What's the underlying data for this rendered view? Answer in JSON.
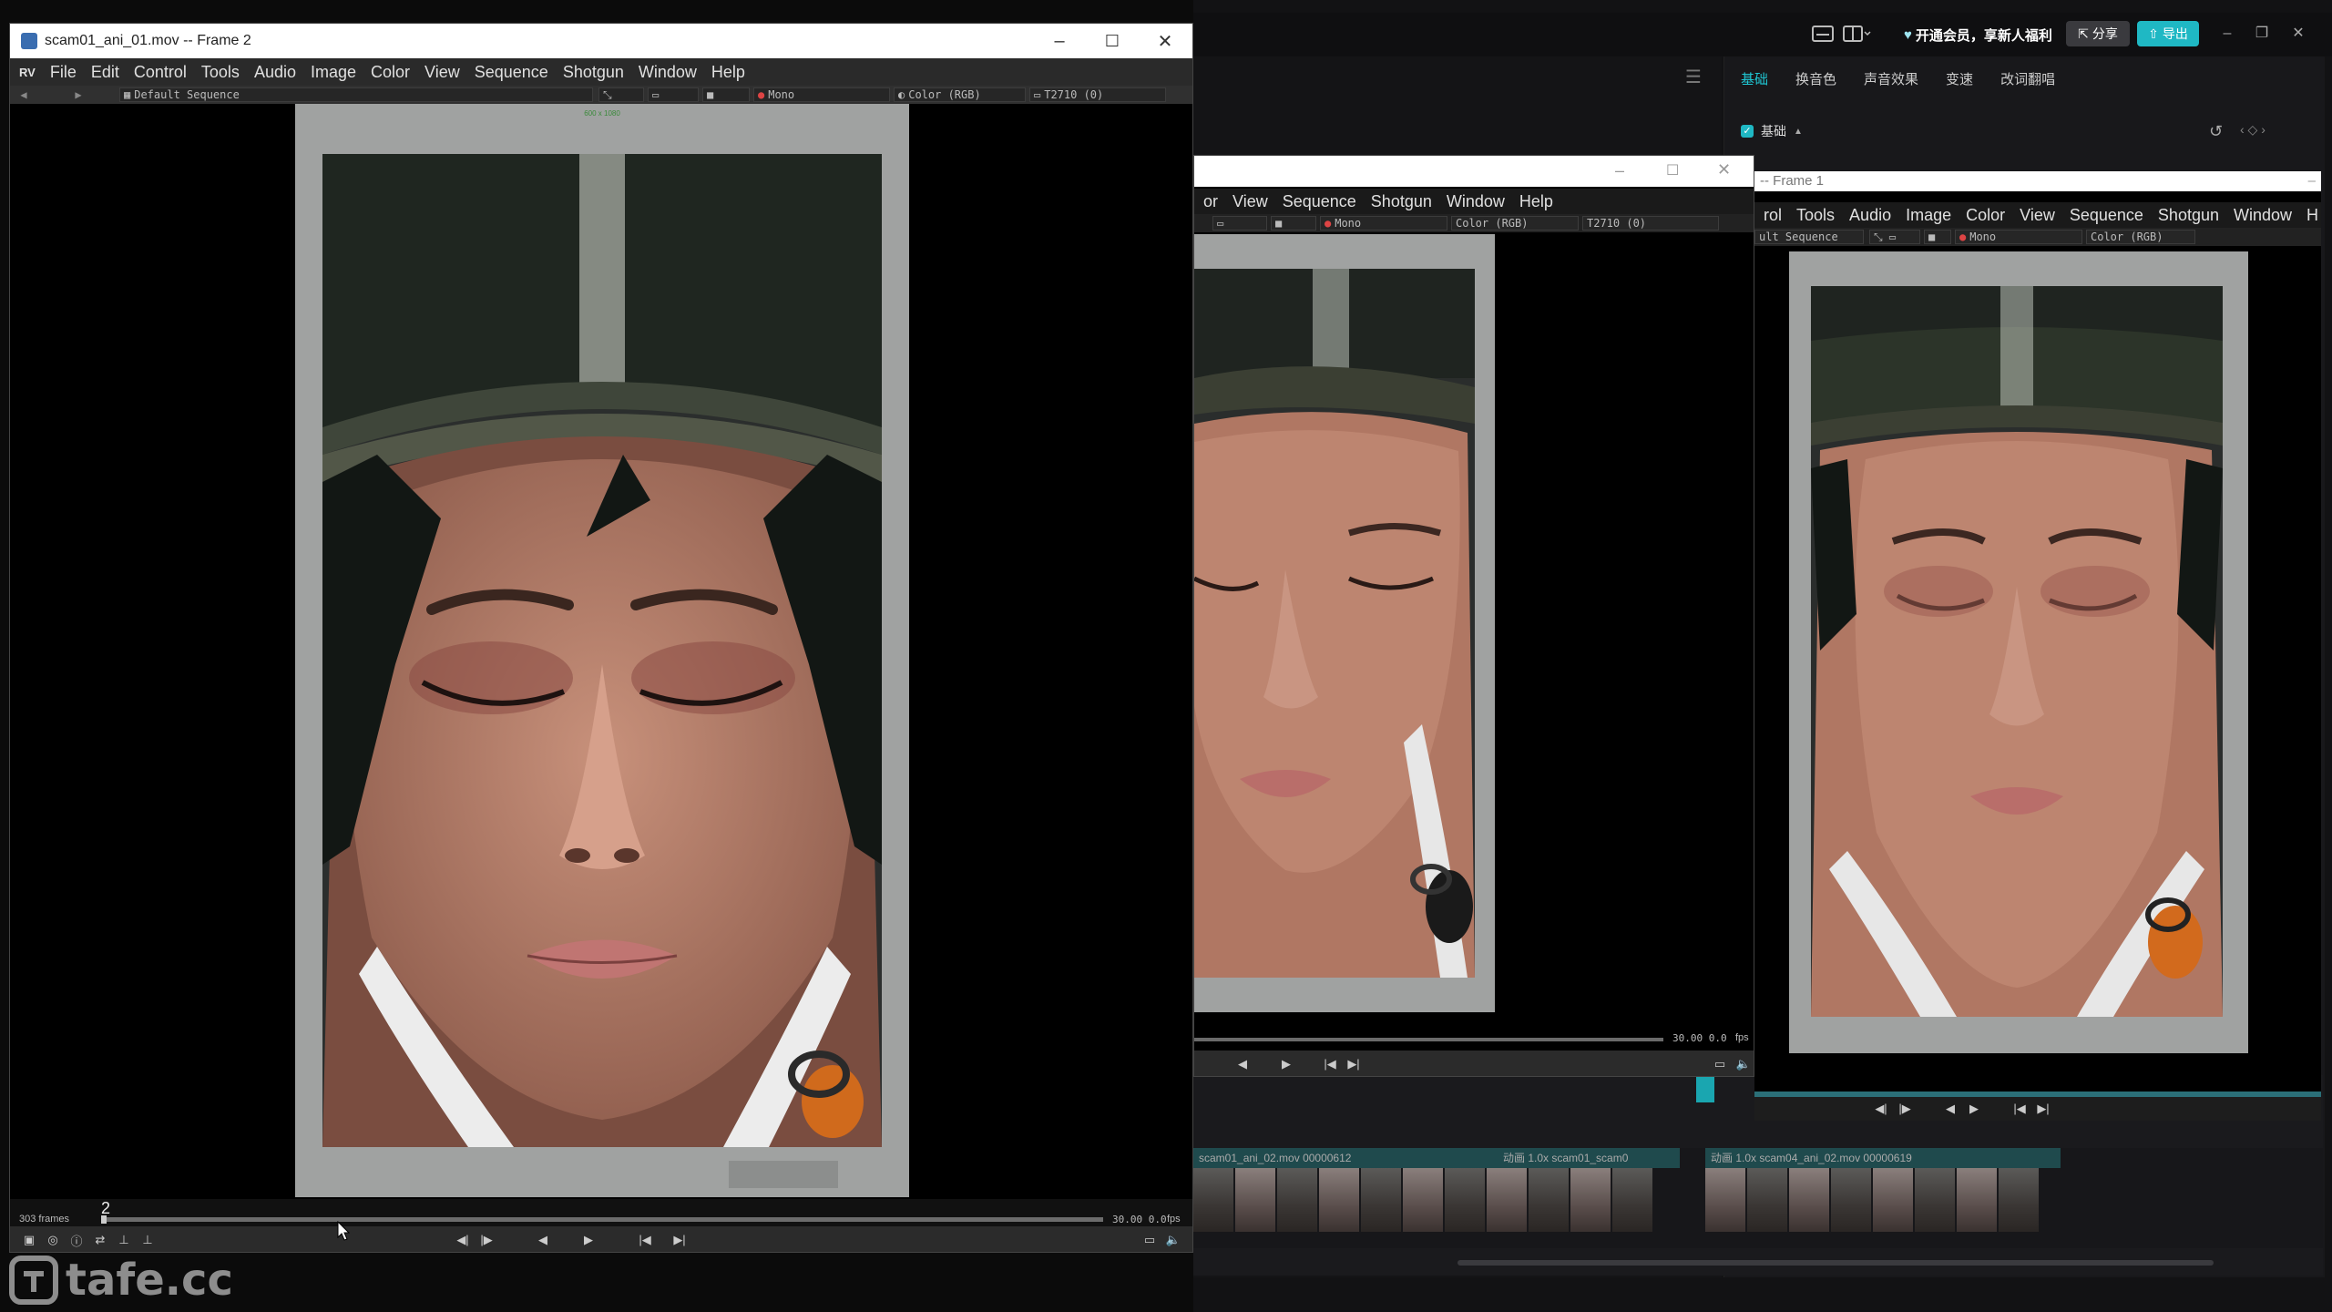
{
  "editor": {
    "member_text": "开通会员，享新人福利",
    "share_label": "分享",
    "export_label": "导出",
    "tabs": [
      "基础",
      "换音色",
      "声音效果",
      "变速",
      "改词翻唱"
    ],
    "active_tab": "基础",
    "basic_label": "基础",
    "accent_color": "#1fb8c4",
    "tracks": [
      {
        "label": "scam01_ani_02.mov 00000612"
      },
      {
        "label": "动画 1.0x  scam01_scam0"
      },
      {
        "label": "动画 1.0x  scam04_ani_02.mov 00000619"
      }
    ]
  },
  "rv_main": {
    "title": "scam01_ani_01.mov -- Frame 2",
    "menu": [
      "RV",
      "File",
      "Edit",
      "Control",
      "Tools",
      "Audio",
      "Image",
      "Color",
      "View",
      "Sequence",
      "Shotgun",
      "Window",
      "Help"
    ],
    "toolbar": {
      "sequence": "Default Sequence",
      "channel": "Mono",
      "color": "Color (RGB)",
      "display": "T2710 (0)"
    },
    "frame_header": "600 x 1080",
    "frames_count": "303 frames",
    "current_frame": "2",
    "fps_readout": "30.00  0.0",
    "fps_unit": "fps",
    "progress": 0.005
  },
  "rv_mid": {
    "title": "",
    "menu": [
      "or",
      "View",
      "Sequence",
      "Shotgun",
      "Window",
      "Help"
    ],
    "toolbar": {
      "channel": "Mono",
      "color": "Color (RGB)",
      "display": "T2710 (0)"
    },
    "fps_readout": "30.00  0.0",
    "fps_unit": "fps"
  },
  "rv_right": {
    "title": "-- Frame 1",
    "menu": [
      "rol",
      "Tools",
      "Audio",
      "Image",
      "Color",
      "View",
      "Sequence",
      "Shotgun",
      "Window",
      "H"
    ],
    "toolbar": {
      "sequence": "ult Sequence",
      "channel": "Mono",
      "color": "Color (RGB)"
    }
  },
  "watermark": "tafe.cc"
}
